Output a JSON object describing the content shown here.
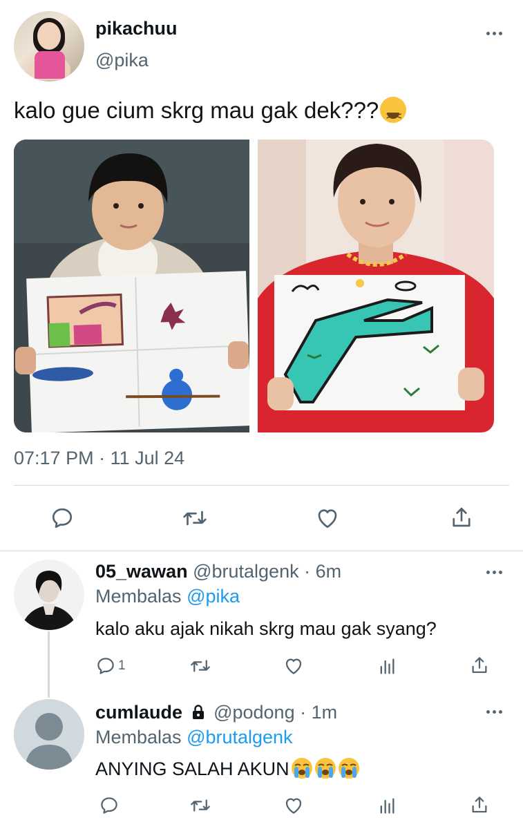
{
  "main_tweet": {
    "display_name": "pikachuu",
    "handle": "@pika",
    "text": "kalo gue cium skrg mau gak dek???",
    "text_emoji": "tired-face-emoji",
    "timestamp": "07:17 PM · 11 Jul 24",
    "actions": [
      "reply-icon",
      "retweet-icon",
      "like-icon",
      "share-icon"
    ]
  },
  "replies": [
    {
      "display_name": "05_wawan",
      "handle": "@brutalgenk",
      "separator": "·",
      "time": "6m",
      "replying_label": "Membalas",
      "replying_to": "@pika",
      "text": "kalo aku ajak nikah skrg mau gak syang?",
      "reply_count": "1"
    },
    {
      "display_name": "cumlaude",
      "handle": "@podong",
      "separator": "·",
      "time": "1m",
      "replying_label": "Membalas",
      "replying_to": "@brutalgenk",
      "text": "ANYING SALAH AKUN",
      "text_emoji": "loudly-crying-face-emoji x3",
      "protected": "lock-icon"
    }
  ],
  "colors": {
    "text": "#0f1419",
    "secondary": "#536471",
    "accent": "#1d9bf0",
    "divider": "#cfd9de"
  }
}
